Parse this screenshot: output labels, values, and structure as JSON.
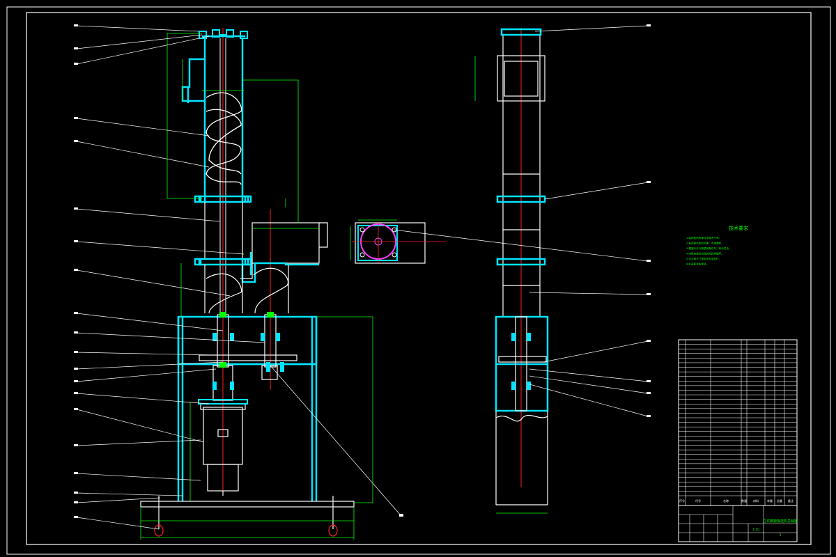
{
  "drawing": {
    "tech_title": "技术要求",
    "tech_notes": [
      "1.装配前所有零件须清洗干净。",
      "2.各连接处密封可靠，不得漏料。",
      "3.螺旋叶片与管壁间隙均匀，转动灵活。",
      "4.电机安装后试运转无异常噪声。",
      "5.未注明尺寸按相关标准执行。",
      "6.外表面涂防锈漆。"
    ],
    "bom_header": [
      "序号",
      "代号",
      "名称",
      "数量",
      "材料",
      "单重",
      "总重",
      "备注"
    ],
    "bom_row_count": 34,
    "title_block": {
      "drawing_name": "立式螺旋输送机总装图",
      "scale": "1:10",
      "sheet": "1"
    },
    "colors": {
      "background": "#000000",
      "frame": "#ffffff",
      "part_outline": "#00e5ff",
      "dimension": "#00ff00",
      "center_line": "#ff2020",
      "leader": "#ffffff",
      "housing": "#ffffff"
    }
  }
}
